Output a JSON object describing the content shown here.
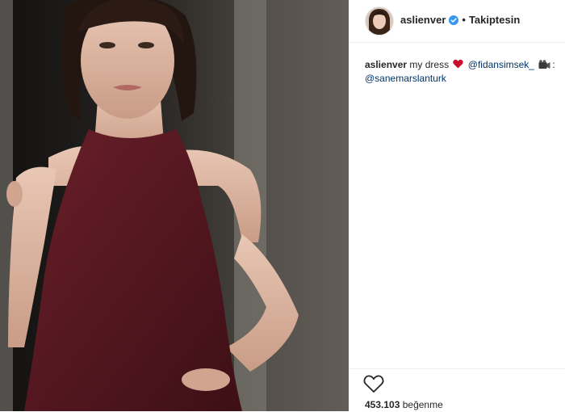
{
  "post": {
    "username": "aslienver",
    "follow_status": "Takiptesin",
    "dot": "•",
    "caption": {
      "username": "aslienver",
      "text_before": "my dress",
      "mention1": "@fidansimsek_",
      "separator": ":",
      "mention2": "@sanemarslanturk"
    },
    "likes": {
      "count": "453.103",
      "label": "beğenme"
    },
    "icons": {
      "verified": "verified-badge-icon",
      "heart_emoji": "red-heart-emoji",
      "camera_emoji": "movie-camera-emoji",
      "like": "heart-outline-icon"
    },
    "colors": {
      "dress": "#5a1a22",
      "verified": "#3897f0",
      "mention": "#003569",
      "heart": "#c8102e"
    }
  }
}
